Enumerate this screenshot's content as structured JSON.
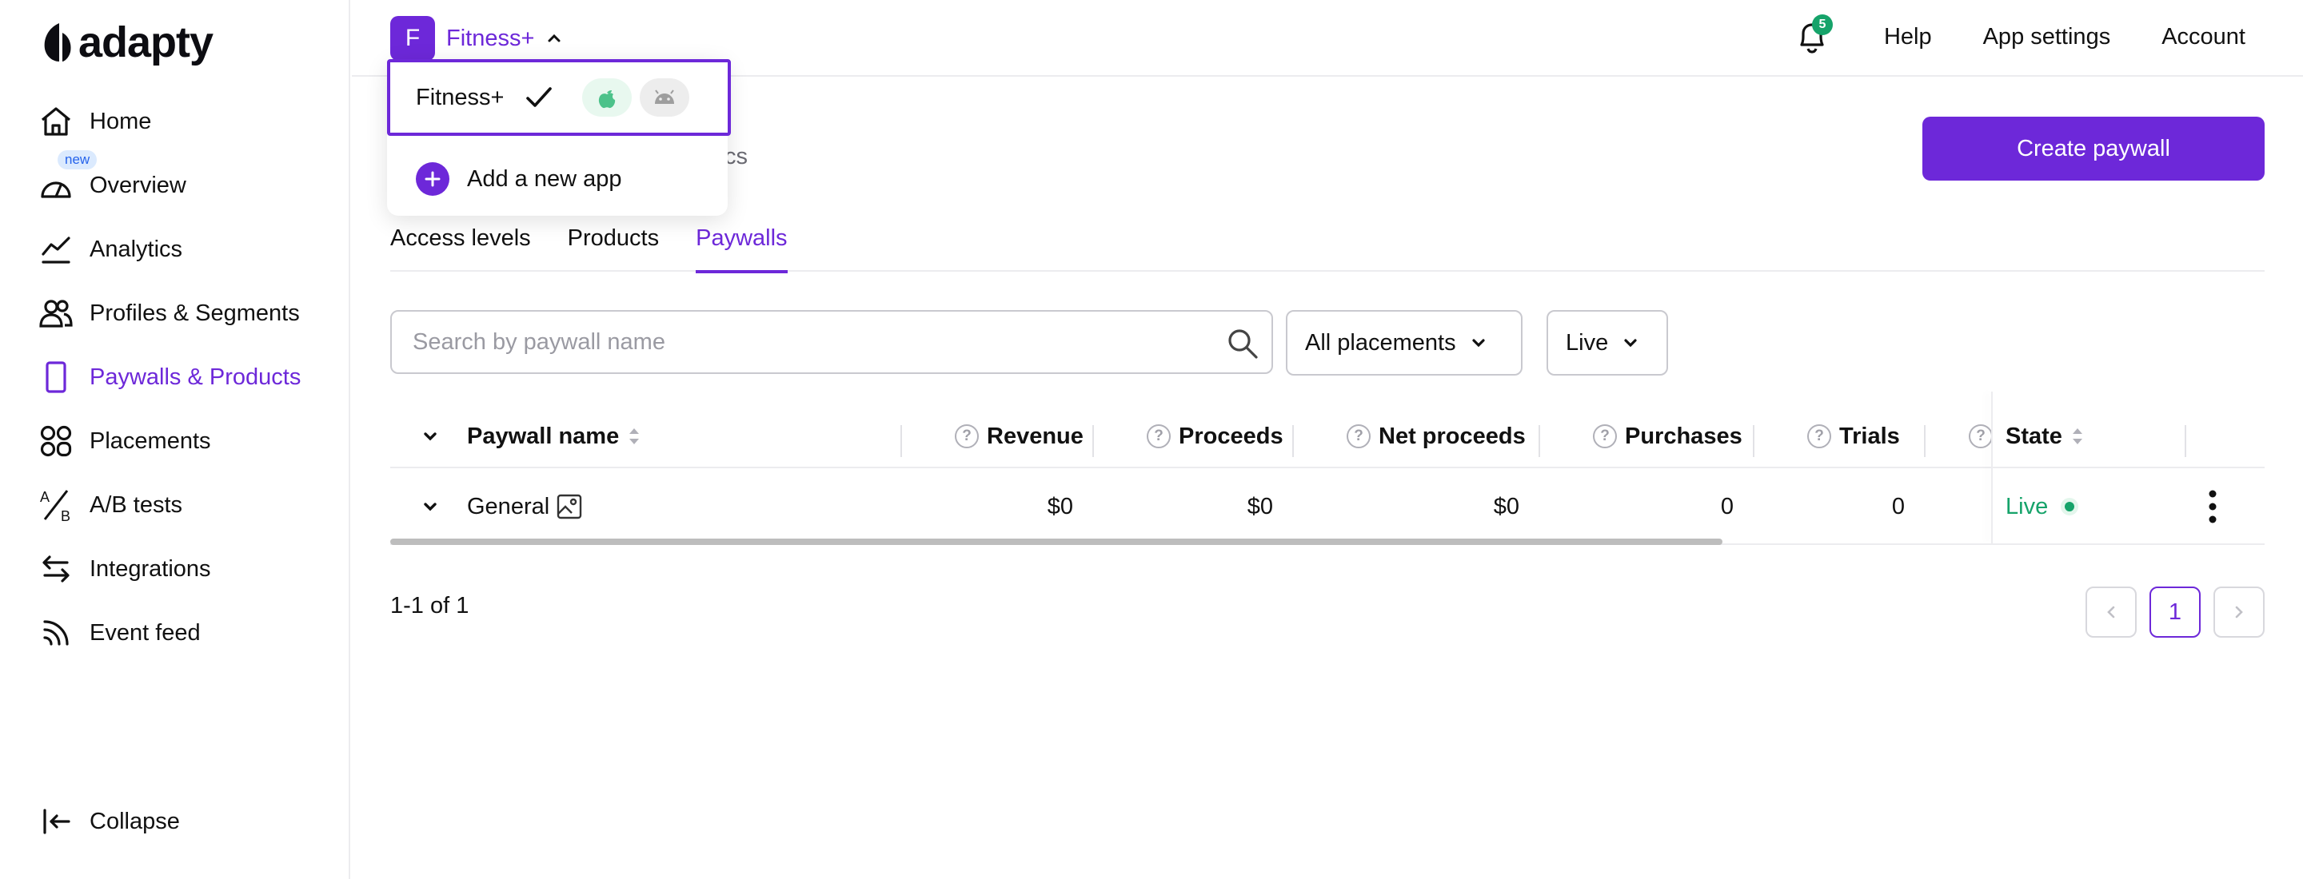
{
  "brand": {
    "name": "adapty"
  },
  "sidebar": {
    "items": [
      {
        "label": "Home",
        "icon": "home-icon"
      },
      {
        "label": "Overview",
        "icon": "gauge-icon",
        "badge": "new"
      },
      {
        "label": "Analytics",
        "icon": "chart-line-icon"
      },
      {
        "label": "Profiles & Segments",
        "icon": "users-icon"
      },
      {
        "label": "Paywalls & Products",
        "icon": "phone-icon",
        "active": true
      },
      {
        "label": "Placements",
        "icon": "grid-circles-icon"
      },
      {
        "label": "A/B tests",
        "icon": "ab-test-icon"
      },
      {
        "label": "Integrations",
        "icon": "arrows-swap-icon"
      },
      {
        "label": "Event feed",
        "icon": "feed-icon"
      }
    ],
    "collapse_label": "Collapse"
  },
  "topbar": {
    "app_initial": "F",
    "app_name": "Fitness+",
    "notifications_count": "5",
    "help": "Help",
    "app_settings": "App settings",
    "account": "Account"
  },
  "app_dropdown": {
    "selected_app": "Fitness+",
    "platforms": [
      "apple-icon",
      "android-icon"
    ],
    "add_label": "Add a new app"
  },
  "page": {
    "subtitle_fragment": "cs",
    "create_button": "Create paywall",
    "tabs": [
      {
        "label": "Access levels"
      },
      {
        "label": "Products"
      },
      {
        "label": "Paywalls",
        "active": true
      }
    ]
  },
  "filters": {
    "search_placeholder": "Search by paywall name",
    "placements": "All placements",
    "status": "Live"
  },
  "table": {
    "headers": {
      "name": "Paywall name",
      "revenue": "Revenue",
      "proceeds": "Proceeds",
      "net_proceeds": "Net proceeds",
      "purchases": "Purchases",
      "trials": "Trials",
      "state": "State"
    },
    "rows": [
      {
        "name": "General",
        "revenue": "$0",
        "proceeds": "$0",
        "net_proceeds": "$0",
        "purchases": "0",
        "trials": "0",
        "state": "Live"
      }
    ]
  },
  "pagination": {
    "range": "1-1 of 1",
    "current_page": "1"
  },
  "colors": {
    "accent": "#6d28d9",
    "live": "#16a36a",
    "badge_bg": "#dbeafe"
  }
}
